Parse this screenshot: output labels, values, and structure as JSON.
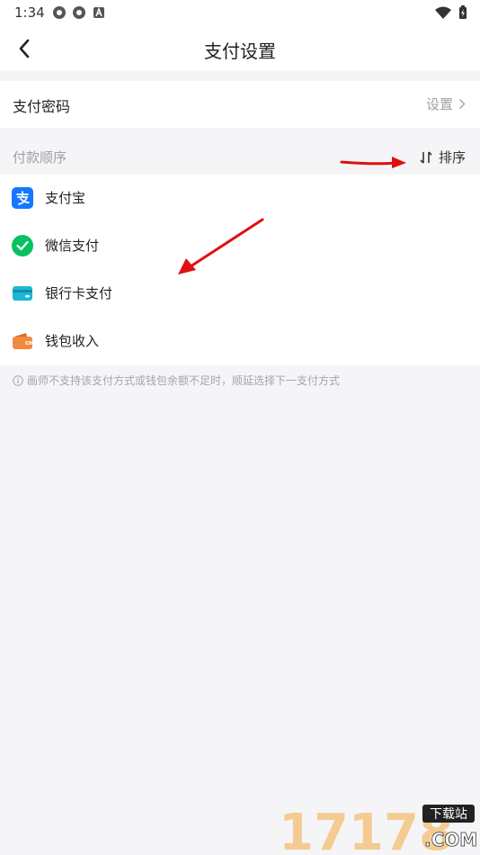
{
  "status_bar": {
    "time": "1:34"
  },
  "header": {
    "title": "支付设置"
  },
  "payment_password": {
    "label": "支付密码",
    "action": "设置"
  },
  "payment_order": {
    "label": "付款顺序",
    "sort_label": "排序"
  },
  "methods": [
    {
      "name": "支付宝",
      "icon": "alipay-icon"
    },
    {
      "name": "微信支付",
      "icon": "wechat-pay-icon"
    },
    {
      "name": "银行卡支付",
      "icon": "bank-card-icon"
    },
    {
      "name": "钱包收入",
      "icon": "wallet-icon"
    }
  ],
  "note": "画师不支持该支付方式或钱包余额不足时，顺延选择下一支付方式",
  "watermark": {
    "main": "17178",
    "badge": "下载站",
    "suffix": ".COM"
  },
  "colors": {
    "alipay": "#1677ff",
    "wechat": "#07c160",
    "bank": "#1fb6d6",
    "wallet": "#f08a3c",
    "annotation_arrow": "#e01010"
  }
}
